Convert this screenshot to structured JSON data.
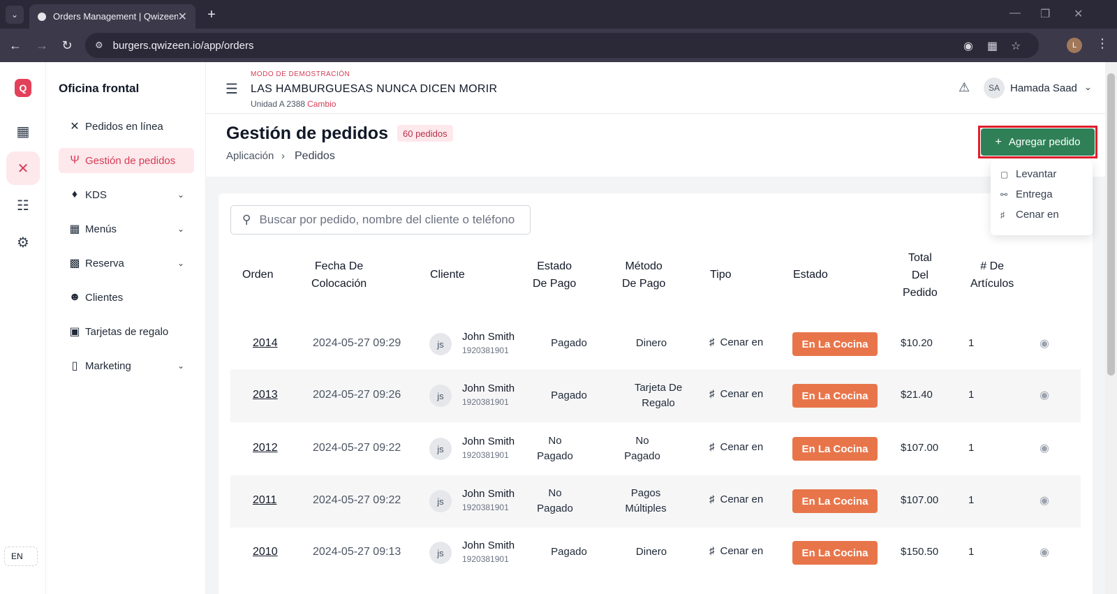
{
  "browser": {
    "tab_title": "Orders Management | Qwizeen",
    "url": "burgers.qwizeen.io/app/orders",
    "profile_initial": "L"
  },
  "rail": {
    "lang": "EN",
    "logo": "Q"
  },
  "sidebar": {
    "title": "Oficina frontal",
    "items": [
      {
        "label": "Pedidos en línea",
        "icon": "fork-knife-icon",
        "has_chevron": false
      },
      {
        "label": "Gestión de pedidos",
        "icon": "utensils-icon",
        "has_chevron": false,
        "active": true
      },
      {
        "label": "KDS",
        "icon": "chef-hat-icon",
        "has_chevron": true
      },
      {
        "label": "Menús",
        "icon": "grid-icon",
        "has_chevron": true
      },
      {
        "label": "Reserva",
        "icon": "floorplan-icon",
        "has_chevron": true
      },
      {
        "label": "Clientes",
        "icon": "users-icon",
        "has_chevron": false
      },
      {
        "label": "Tarjetas de regalo",
        "icon": "gift-icon",
        "has_chevron": false
      },
      {
        "label": "Marketing",
        "icon": "chart-icon",
        "has_chevron": true
      }
    ]
  },
  "topbar": {
    "demo_mode": "MODO DE DEMOSTRACIÓN",
    "restaurant": "LAS HAMBURGUESAS NUNCA DICEN MORIR",
    "unit": "Unidad A 2388",
    "change": "Cambio",
    "user_initials": "SA",
    "user_name": "Hamada Saad"
  },
  "header": {
    "title": "Gestión de pedidos",
    "count": "60 pedidos",
    "breadcrumb_root": "Aplicación",
    "breadcrumb_current": "Pedidos",
    "add_button": "Agregar pedido"
  },
  "dropdown": {
    "items": [
      "Levantar",
      "Entrega",
      "Cenar en"
    ]
  },
  "search": {
    "placeholder": "Buscar por pedido, nombre del cliente o teléfono"
  },
  "table": {
    "headers": {
      "order": "Orden",
      "date": [
        "Fecha De",
        "Colocación"
      ],
      "customer": "Cliente",
      "payment_status": [
        "Estado",
        "De Pago"
      ],
      "payment_method": [
        "Método",
        "De Pago"
      ],
      "type": "Tipo",
      "status": "Estado",
      "total": [
        "Total",
        "Del",
        "Pedido"
      ],
      "items": [
        "# De",
        "Artículos"
      ]
    },
    "rows": [
      {
        "order": "2014",
        "date": "2024-05-27 09:29",
        "initials": "js",
        "name": "John Smith",
        "phone": "1920381901",
        "payment_status": [
          "Pagado"
        ],
        "payment_method": [
          "Dinero"
        ],
        "type": "Cenar en",
        "status": "En La Cocina",
        "total": "$10.20",
        "items": "1"
      },
      {
        "order": "2013",
        "date": "2024-05-27 09:26",
        "initials": "js",
        "name": "John Smith",
        "phone": "1920381901",
        "payment_status": [
          "Pagado"
        ],
        "payment_method": [
          "Tarjeta De",
          "Regalo"
        ],
        "type": "Cenar en",
        "status": "En La Cocina",
        "total": "$21.40",
        "items": "1"
      },
      {
        "order": "2012",
        "date": "2024-05-27 09:22",
        "initials": "js",
        "name": "John Smith",
        "phone": "1920381901",
        "payment_status": [
          "No",
          "Pagado"
        ],
        "payment_method": [
          "No",
          "Pagado"
        ],
        "type": "Cenar en",
        "status": "En La Cocina",
        "total": "$107.00",
        "items": "1"
      },
      {
        "order": "2011",
        "date": "2024-05-27 09:22",
        "initials": "js",
        "name": "John Smith",
        "phone": "1920381901",
        "payment_status": [
          "No",
          "Pagado"
        ],
        "payment_method": [
          "Pagos",
          "Múltiples"
        ],
        "type": "Cenar en",
        "status": "En La Cocina",
        "total": "$107.00",
        "items": "1"
      },
      {
        "order": "2010",
        "date": "2024-05-27 09:13",
        "initials": "js",
        "name": "John Smith",
        "phone": "1920381901",
        "payment_status": [
          "Pagado"
        ],
        "payment_method": [
          "Dinero"
        ],
        "type": "Cenar en",
        "status": "En La Cocina",
        "total": "$150.50",
        "items": "1"
      }
    ]
  },
  "colors": {
    "brand": "#e3405a",
    "primary_button": "#2f8057",
    "status_kitchen": "#e8754a",
    "highlight_outline": "#e11d2a"
  }
}
